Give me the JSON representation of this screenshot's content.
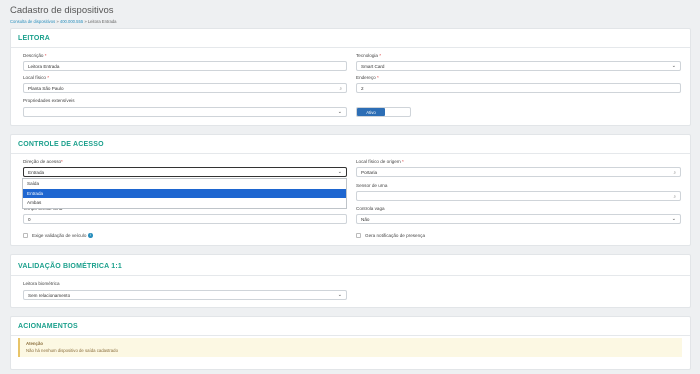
{
  "header": {
    "title": "Cadastro de dispositivos",
    "breadcrumb": [
      "Consulta de dispositivos",
      "400.000.555",
      "Leitora Entrada"
    ]
  },
  "leitora": {
    "title": "LEITORA",
    "descricao": {
      "label": "Descrição",
      "value": "Leitora Entrada"
    },
    "tecnologia": {
      "label": "Tecnologia",
      "value": "Smart Card"
    },
    "local_fisico": {
      "label": "Local físico",
      "value": "Planta São Paulo"
    },
    "endereco": {
      "label": "Endereço",
      "value": "2"
    },
    "propriedades": {
      "label": "Propriedades extensíveis",
      "value": ""
    },
    "ativo_label": "Ativo"
  },
  "controle": {
    "title": "CONTROLE DE ACESSO",
    "direcao": {
      "label": "Direção de acesso",
      "value": "Entrada",
      "options": [
        "Saída",
        "Entrada",
        "Ambas"
      ],
      "selected_index": 1
    },
    "local_origem": {
      "label": "Local físico de origem",
      "value": "Portaria"
    },
    "sensor_urna": {
      "label": "Sensor de urna",
      "value": ""
    },
    "tempo_sensor": {
      "label": "Tempo sensor urna",
      "value": "0"
    },
    "controla_vaga": {
      "label": "Controla vaga",
      "value": "Não"
    },
    "exige_validacao": "Exige validação de veículo",
    "gera_notificacao": "Gera notificação de presença"
  },
  "biometria": {
    "title": "VALIDAÇÃO BIOMÉTRICA 1:1",
    "leitora": {
      "label": "Leitora biométrica",
      "value": "Sem relacionamento"
    }
  },
  "acionamentos": {
    "title": "ACIONAMENTOS",
    "alert_title": "Atenção",
    "alert_text": "Não há nenhum dispositivo de saída cadastrado"
  }
}
